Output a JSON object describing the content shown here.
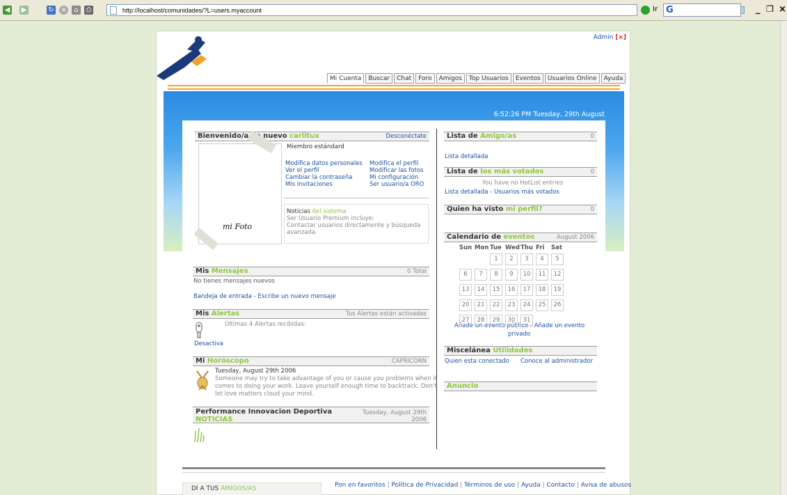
{
  "browser": {
    "url": "http://localhost/comunidades/?L=users.myaccount",
    "go_label": "Ir",
    "search_label": "G"
  },
  "header": {
    "admin_label": "Admin",
    "admin_mark": "[×]",
    "tabs": [
      "Mi Cuenta",
      "Buscar",
      "Chat",
      "Foro",
      "Amigos",
      "Top Usuarios",
      "Eventos",
      "Usuarios Online",
      "Ayuda"
    ],
    "datetime": "6:52:26 PM Tuesday, 29th August"
  },
  "welcome": {
    "title": "Bienvenido/a de nuevo",
    "username": "carlitux",
    "logout": "Desconéctate",
    "member_type": "Miembro estándard",
    "photo_label": "mi Foto",
    "links_left": [
      "Modifica datos personales",
      "Ver el perfil",
      "Cambiar la contraseña",
      "Mis invitaciones"
    ],
    "links_right": [
      "Modifica el perfil",
      "Modificar las fotos",
      "Mi configuración",
      "Ser usuario/a ORO"
    ],
    "news_title": "Noticias",
    "news_title_hl": "del sistema",
    "news_lines": [
      "Ser Usuario Premium incluye:",
      "Contactar usuarios directamente y búsqueda",
      "avanzada."
    ]
  },
  "messages": {
    "title": "Mis",
    "title_hl": "Mensajes",
    "total": "0 Total",
    "none": "No tienes mensajes nuevos",
    "link_inbox": "Bandeja de entrada",
    "sep": " - ",
    "link_write": "Escribe un nuevo mensaje"
  },
  "alerts": {
    "title": "Mis",
    "title_hl": "Alertas",
    "status": "Tus Alertas están activadas",
    "received": "Últimas 4 Alertas recibidas:",
    "deactivate": "Desactiva"
  },
  "horoscope": {
    "title": "Mi",
    "title_hl": "Horóscopo",
    "sign": "CAPRICORN",
    "date": "Tuesday, August 29th 2006",
    "lines": [
      "Someone may try to take advantage of you or cause you problems when it",
      "comes to doing your work. Leave yourself enough time to backtrack. Don't",
      "let love matters cloud your mind."
    ]
  },
  "news": {
    "title": "Performance Innovacion Deportiva",
    "date_1": "Tuesday, August 29th",
    "date_2": "2006",
    "label": "NOTICIAS"
  },
  "friends": {
    "title": "Lista de",
    "title_hl": "Amigo/as",
    "count": "0",
    "link": "Lista detallada"
  },
  "top_voted": {
    "title": "Lista de",
    "title_hl": "los más votados",
    "count": "0",
    "empty": "You have no HotList entries",
    "link_detail": "Lista detallada",
    "sep": " - ",
    "link_top": "Usuarios más votados"
  },
  "viewed": {
    "title": "Quien ha visto",
    "title_hl": "mi perfil?",
    "count": "0"
  },
  "calendar": {
    "title": "Calendario de",
    "title_hl": "eventos",
    "month": "August 2006",
    "weekdays": [
      "Sun",
      "Mon",
      "Tue",
      "Wed",
      "Thu",
      "Fri",
      "Sat"
    ],
    "days": [
      "1",
      "2",
      "3",
      "4",
      "5",
      "6",
      "7",
      "8",
      "9",
      "10",
      "11",
      "12",
      "13",
      "14",
      "15",
      "16",
      "17",
      "18",
      "19",
      "20",
      "21",
      "22",
      "23",
      "24",
      "25",
      "26",
      "27",
      "28",
      "29",
      "30",
      "31"
    ],
    "link_1": "Añade un evento público - Añade un evento",
    "link_2": "privado"
  },
  "misc": {
    "title": "Miscelánea",
    "title_hl": "Utilidades",
    "link_who": "Quien esta conectado",
    "link_admin": "Conoce al administrador"
  },
  "ad": {
    "title": "Anuncio"
  },
  "footer": {
    "box_text": "DI A TUS",
    "box_hl": "AMIGOS/AS",
    "links": [
      "Pon en favoritos",
      "Política de Privacidad",
      "Términos de uso",
      "Ayuda",
      "Contacto",
      "Avisa de abusos"
    ]
  }
}
